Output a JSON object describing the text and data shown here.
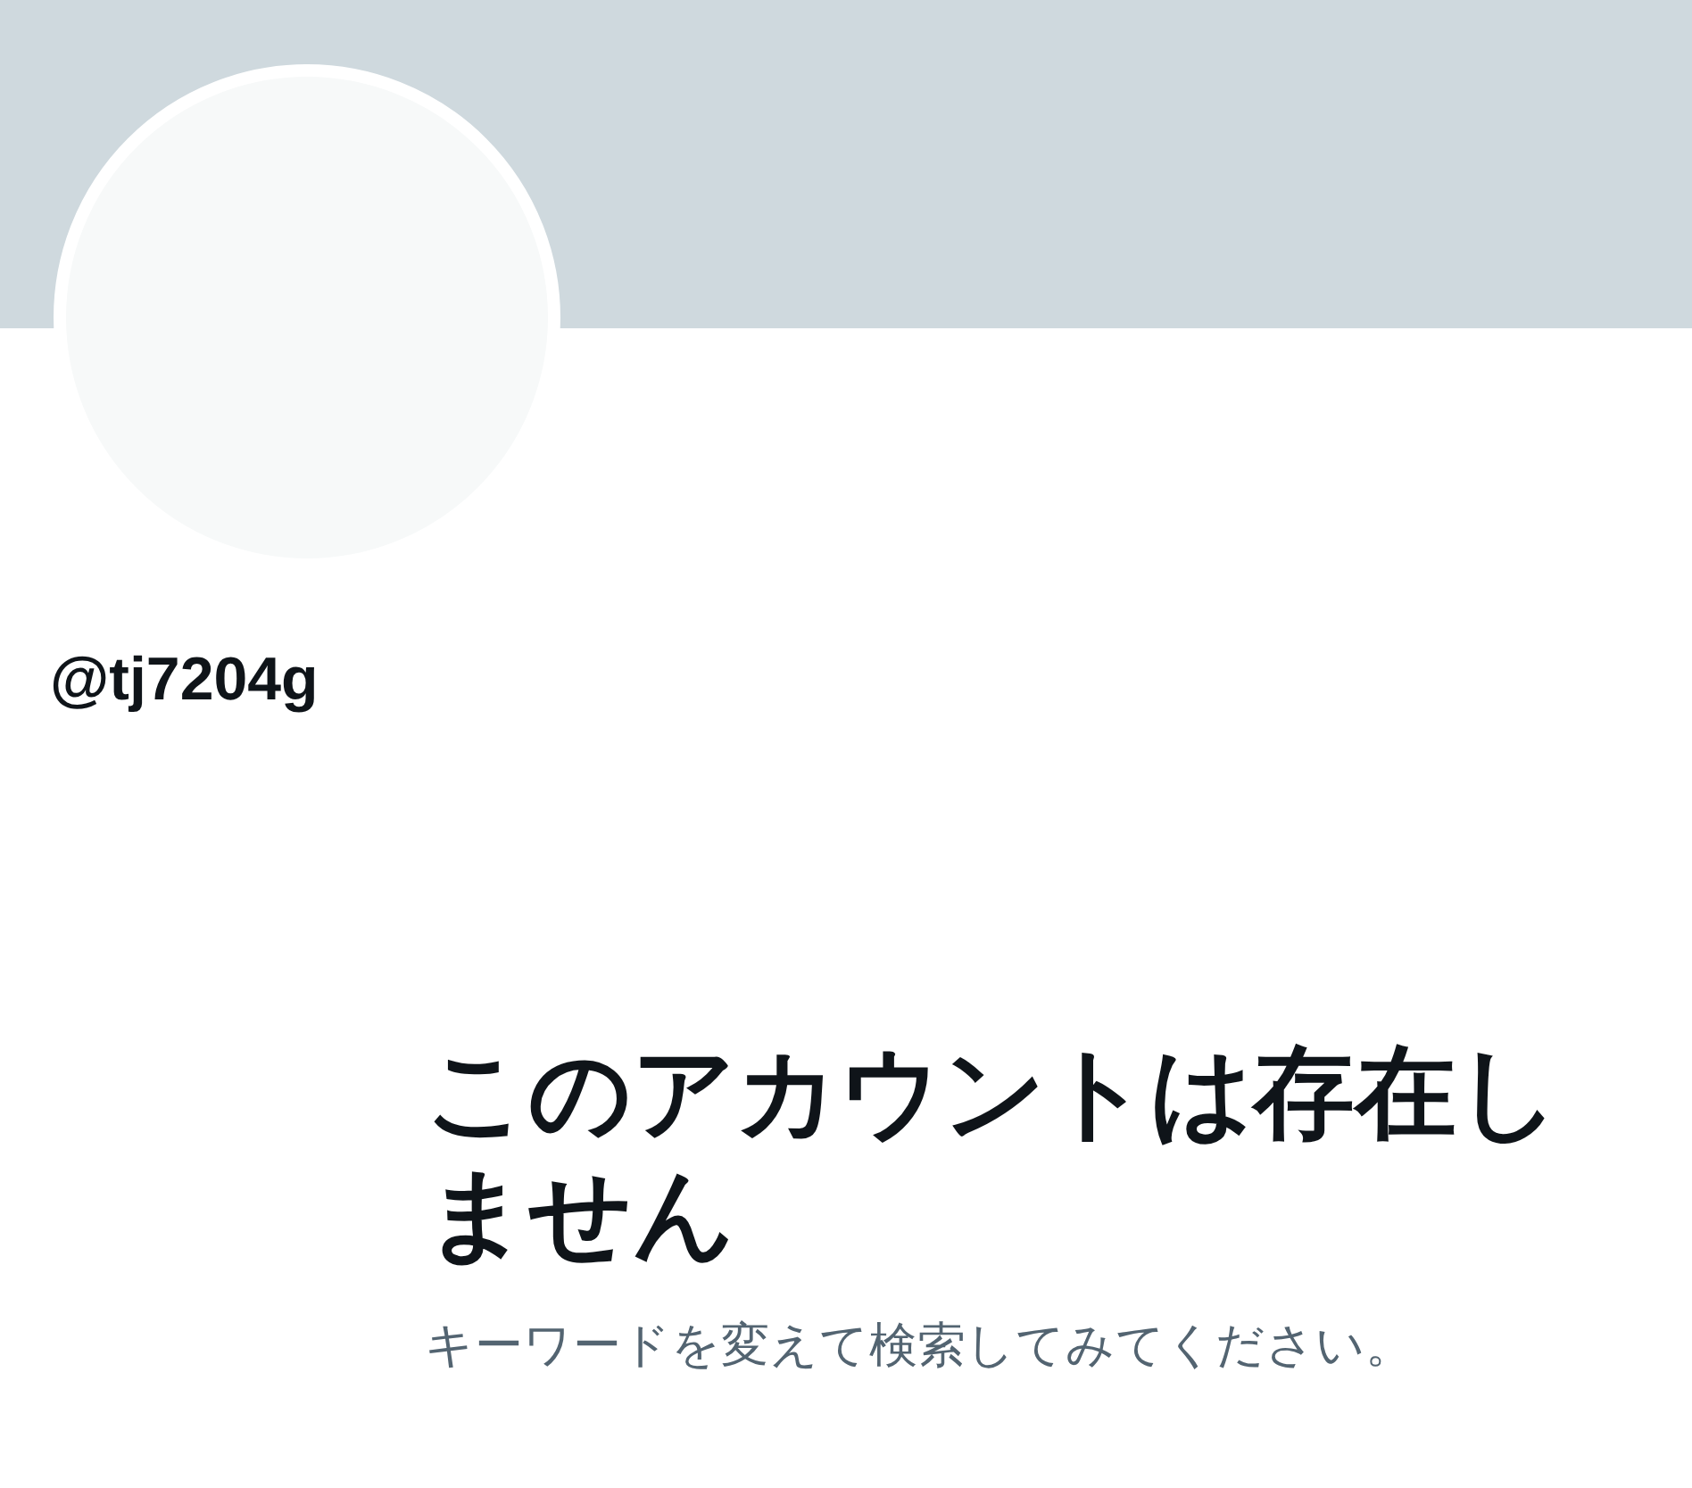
{
  "profile": {
    "handle": "@tj7204g"
  },
  "message": {
    "title": "このアカウントは存在しません",
    "subtitle": "キーワードを変えて検索してみてください。"
  }
}
